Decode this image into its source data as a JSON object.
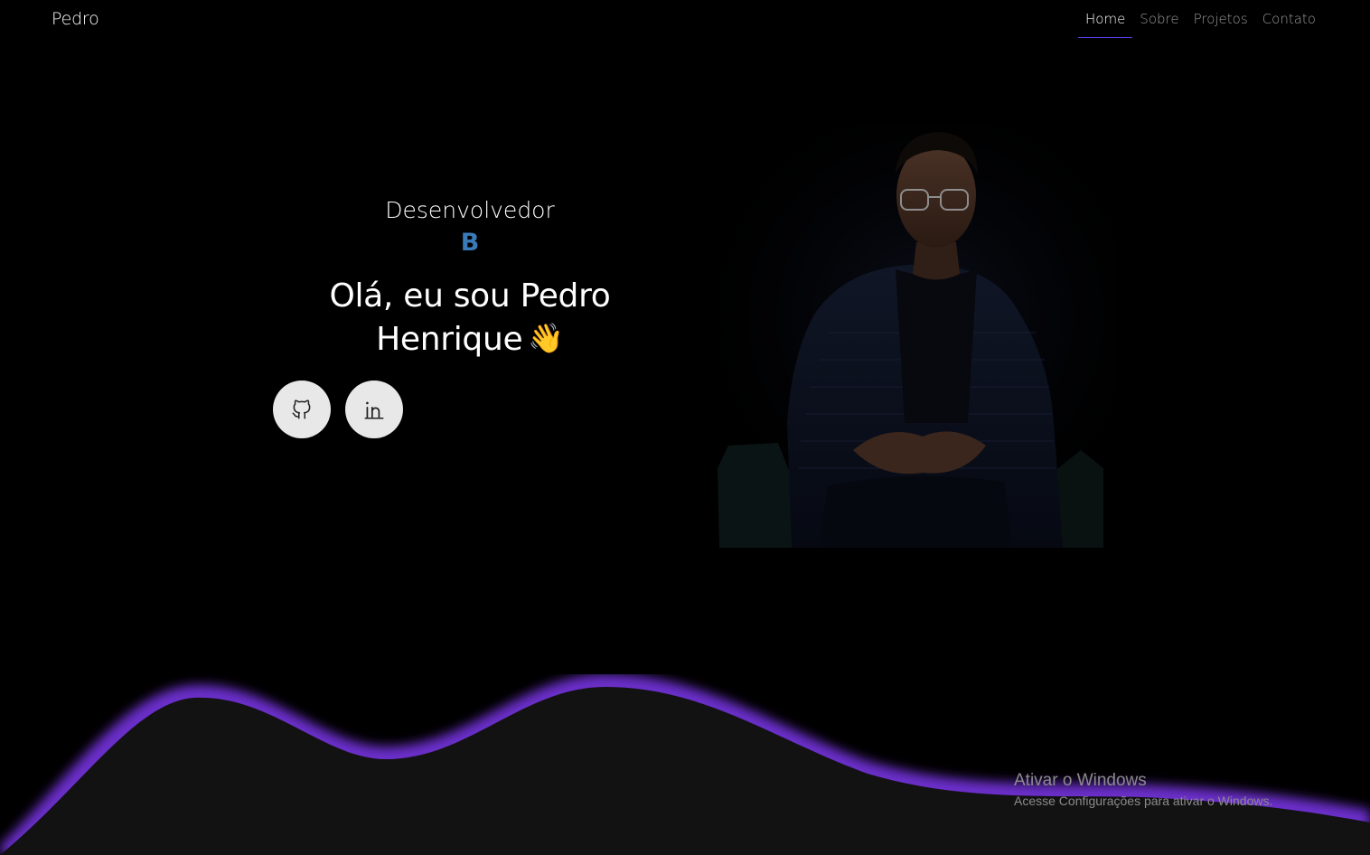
{
  "header": {
    "brand": "Pedro",
    "nav": [
      {
        "label": "Home",
        "active": true
      },
      {
        "label": "Sobre",
        "active": false
      },
      {
        "label": "Projetos",
        "active": false
      },
      {
        "label": "Contato",
        "active": false
      }
    ]
  },
  "hero": {
    "role": "Desenvolvedor",
    "typing_text": "B",
    "greeting_line1": "Olá, eu sou Pedro",
    "greeting_line2": "Henrique",
    "wave_emoji": "👋",
    "social": [
      {
        "icon": "github-icon"
      },
      {
        "icon": "linkedin-icon"
      }
    ]
  },
  "colors": {
    "accent": "#5b3ee6",
    "wave": "#6a2fc9",
    "typing": "#3b7ab8",
    "background": "#000000"
  },
  "watermark": {
    "title": "Ativar o Windows",
    "subtitle": "Acesse Configurações para ativar o Windows."
  }
}
